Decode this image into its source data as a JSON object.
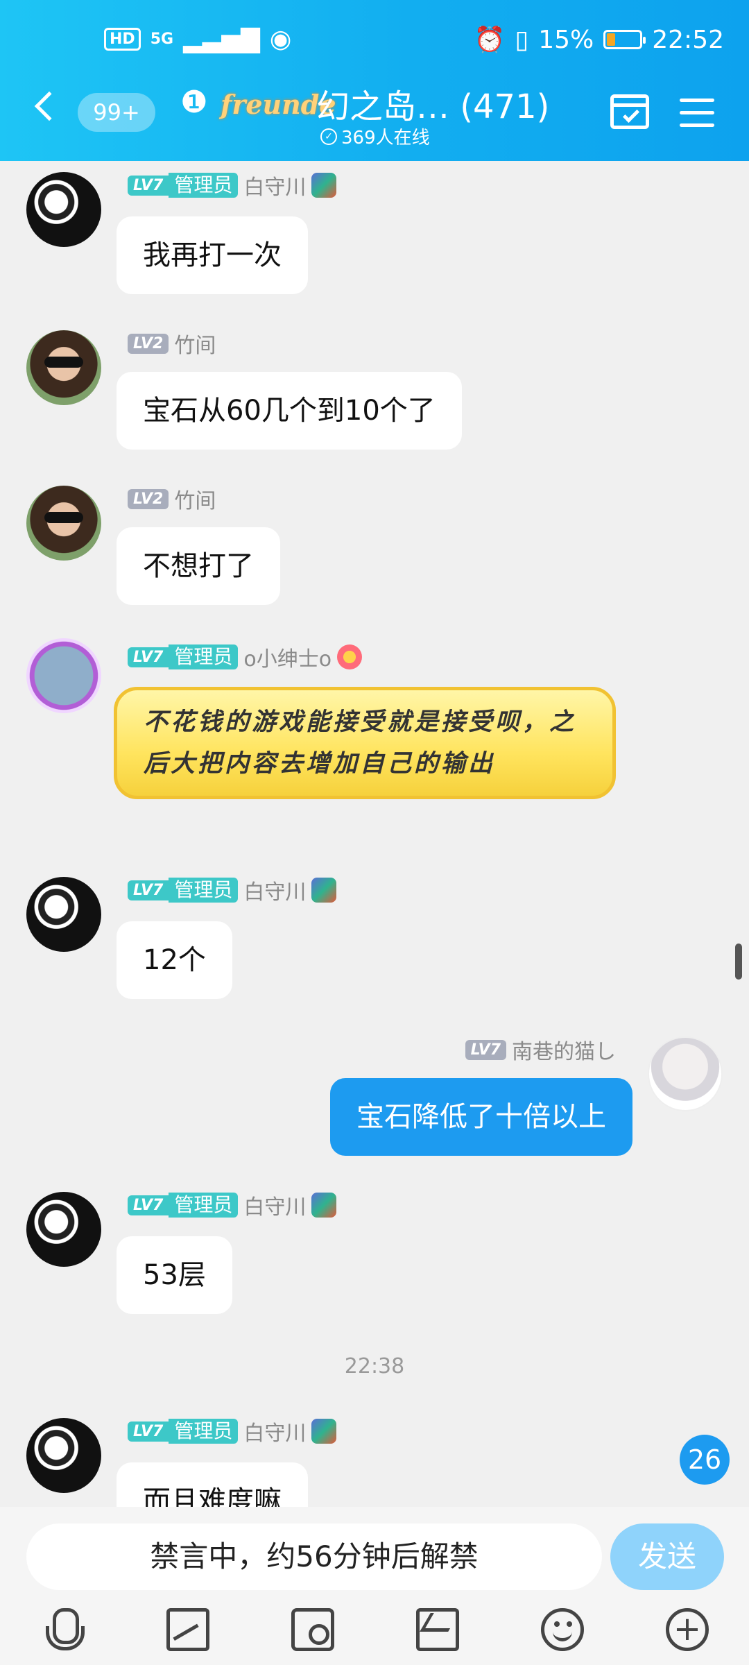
{
  "status": {
    "hd": "HD",
    "signal": "5G",
    "battery_pct": "15%",
    "time": "22:52",
    "battery_color": "#f5a623"
  },
  "header": {
    "unread_badge": "99+",
    "logo_text": "freunde",
    "title": "幻之岛… (471)",
    "online": "369人在线",
    "colors": {
      "gradient_start": "#1ec5f5",
      "gradient_end": "#0da2ee"
    }
  },
  "messages": [
    {
      "level": "LV7",
      "role": "管理员",
      "name": "白守川",
      "text": "我再打一次"
    },
    {
      "level": "LV2",
      "name": "竹间",
      "text": "宝石从60几个到10个了"
    },
    {
      "level": "LV2",
      "name": "竹间",
      "text": "不想打了"
    },
    {
      "level": "LV7",
      "role": "管理员",
      "name": "o小绅士o",
      "text": "不花钱的游戏能接受就是接受呗，之后大把内容去增加自己的输出"
    },
    {
      "level": "LV7",
      "role": "管理员",
      "name": "白守川",
      "text": "12个"
    },
    {
      "level": "LV7",
      "name": "南巷的猫し",
      "text": "宝石降低了十倍以上",
      "self": true
    },
    {
      "level": "LV7",
      "role": "管理员",
      "name": "白守川",
      "text": "53层"
    },
    {
      "level": "LV7",
      "role": "管理员",
      "name": "白守川",
      "text": "而且难度嘛"
    }
  ],
  "timestamp": "22:38",
  "unread_count": "26",
  "input": {
    "placeholder": "禁言中，约56分钟后解禁",
    "send_label": "发送"
  },
  "toolbar": [
    "mic-icon",
    "image-icon",
    "camera-icon",
    "gift-icon",
    "emoji-icon",
    "plus-icon"
  ],
  "accent": "#1d9bf0"
}
